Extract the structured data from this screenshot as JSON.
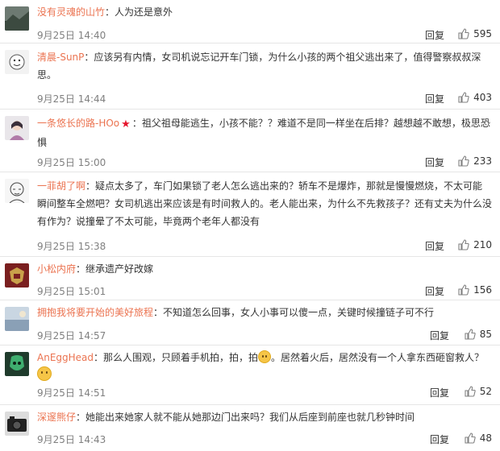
{
  "comments": [
    {
      "name": "没有灵魂的山竹",
      "sep": "：",
      "text": "人为还是意外",
      "time": "9月25日 14:40",
      "reply": "回复",
      "likes": "595",
      "avatar": "landscape-avatar"
    },
    {
      "name": "清晨-SunP",
      "sep": "：",
      "text": "应该另有内情，女司机说忘记开车门锁，为什么小孩的两个祖父逃出来了，值得警察叔叔深思。",
      "time": "9月25日 14:44",
      "reply": "回复",
      "likes": "403",
      "avatar": "cartoon-avatar"
    },
    {
      "name": "一条悠长的路-HOo",
      "sep": "：",
      "text": "祖父祖母能逃生，小孩不能？？难道不是同一样坐在后排？越想越不敢想，极思恐惧",
      "time": "9月25日 15:00",
      "reply": "回复",
      "likes": "233",
      "avatar": "girl-avatar"
    },
    {
      "name": "一菲胡了啊",
      "sep": "：",
      "text": "疑点太多了，车门如果锁了老人怎么逃出来的？轿车不是爆炸，那就是慢慢燃烧，不太可能瞬间整车全燃吧？女司机逃出来应该是有时间救人的。老人能出来，为什么不先救孩子？还有丈夫为什么没有作为？说撞晕了不太可能，毕竟两个老年人都没有",
      "time": "9月25日 15:38",
      "reply": "回复",
      "likes": "210",
      "avatar": "sketch-avatar"
    },
    {
      "name": "小松内府",
      "sep": "：",
      "text": "继承遗产好改嫁",
      "time": "9月25日 15:01",
      "reply": "回复",
      "likes": "156",
      "avatar": "emblem-avatar"
    },
    {
      "name": "拥抱我将要开始的美好旅程",
      "sep": "：",
      "text": "不知道怎么回事，女人小事可以傻一点，关键时候撞链子可不行",
      "time": "9月25日 14:57",
      "reply": "回复",
      "likes": "85",
      "avatar": "scenery-avatar"
    },
    {
      "name": "AnEggHead",
      "sep": "：",
      "text": "那么人围观，只顾着手机拍，拍，拍",
      "text2": "。居然着火后，居然没有一个人拿东西砸窗救人？",
      "time": "9月25日 14:51",
      "reply": "回复",
      "likes": "52",
      "avatar": "mask-avatar"
    },
    {
      "name": "深邃熊仔",
      "sep": "：",
      "text": "她能出来她家人就不能从她那边门出来吗？我们从后座到前座也就几秒钟时间",
      "time": "9月25日 14:43",
      "reply": "回复",
      "likes": "48",
      "avatar": "camera-avatar"
    }
  ],
  "colors": {
    "username": "#eb7350",
    "text": "#333333",
    "time": "#808080",
    "divider": "#e6e6e6"
  }
}
